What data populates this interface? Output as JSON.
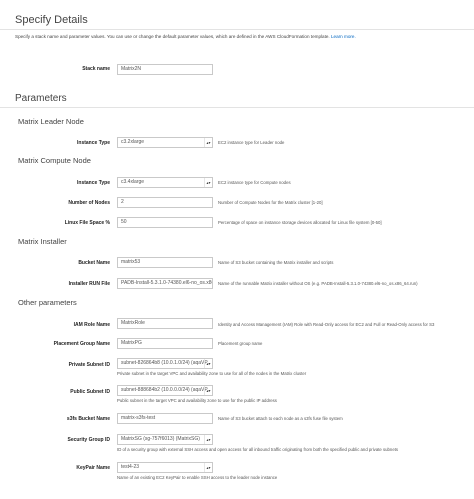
{
  "header": {
    "title": "Specify Details",
    "intro": "Specify a stack name and parameter values. You can use or change the default parameter values, which are defined in the AWS CloudFormation template.",
    "learn_more": "Learn more."
  },
  "stack": {
    "label": "Stack name",
    "value": "Matrix2N"
  },
  "parameters_title": "Parameters",
  "sections": {
    "leader": "Matrix Leader Node",
    "compute": "Matrix Compute Node",
    "installer": "Matrix Installer",
    "other": "Other parameters"
  },
  "fields": {
    "leader_instance_type": {
      "label": "Instance Type",
      "value": "c3.2xlarge",
      "desc": "EC2 instance type for Leader node"
    },
    "compute_instance_type": {
      "label": "Instance Type",
      "value": "c3.4xlarge",
      "desc": "EC2 instance type for Compute nodes"
    },
    "num_nodes": {
      "label": "Number of Nodes",
      "value": "2",
      "desc": "Number of Compute Nodes for the Matrix cluster [1-20]"
    },
    "linux_space": {
      "label": "Linux File Space %",
      "value": "50",
      "desc": "Percentage of space on instance storage devices allocated for Linux file system [0-50]"
    },
    "bucket_name": {
      "label": "Bucket Name",
      "value": "matrix53",
      "desc": "Name of S3 bucket containing the Matrix installer and scripts"
    },
    "installer_run": {
      "label": "Installer RUN File",
      "value": "PADB-Install-5.3.1.0-74380.el6-no_os.x86_64.run",
      "desc": "Name of the runnable Matrix installer without OS (e.g. PADB-Install-5.3.1.0-74380.el6-no_os.x86_64.run)"
    },
    "iam_role": {
      "label": "IAM Role Name",
      "value": "MatrixRole",
      "desc": "Identity and Access Management (IAM) Role with Read-Only access for EC2 and Full or Read-Only access for S3"
    },
    "placement_group": {
      "label": "Placement Group Name",
      "value": "MatrixPG",
      "desc": "Placement group name"
    },
    "private_subnet": {
      "label": "Private Subnet ID",
      "value": "subnet-826864b8 (10.0.1.0/24) (aqaVP…",
      "desc": "Private subnet in the target VPC and availability zone to use for all of the nodes in the Matrix cluster"
    },
    "public_subnet": {
      "label": "Public Subnet ID",
      "value": "subnet-888684b2 (10.0.0.0/24) (aqaVP…",
      "desc": "Public subnet in the target VPC and availability zone to use for the public IP address"
    },
    "s3fs_bucket": {
      "label": "s3fs Bucket Name",
      "value": "matrix-s3fs-test",
      "desc": "Name of S3 bucket attach to each node as a s3fs fuse file system"
    },
    "security_group": {
      "label": "Security Group ID",
      "value": "MatrixSG (sg-757f6013) (MatrixSG)",
      "desc": "ID of a security group with external SSH access and open access for all inbound traffic originating from both the specified public and private subnets"
    },
    "keypair": {
      "label": "KeyPair Name",
      "value": "test4-23",
      "desc": "Name of an existing EC2 KeyPair to enable SSH access to the leader node instance"
    }
  }
}
